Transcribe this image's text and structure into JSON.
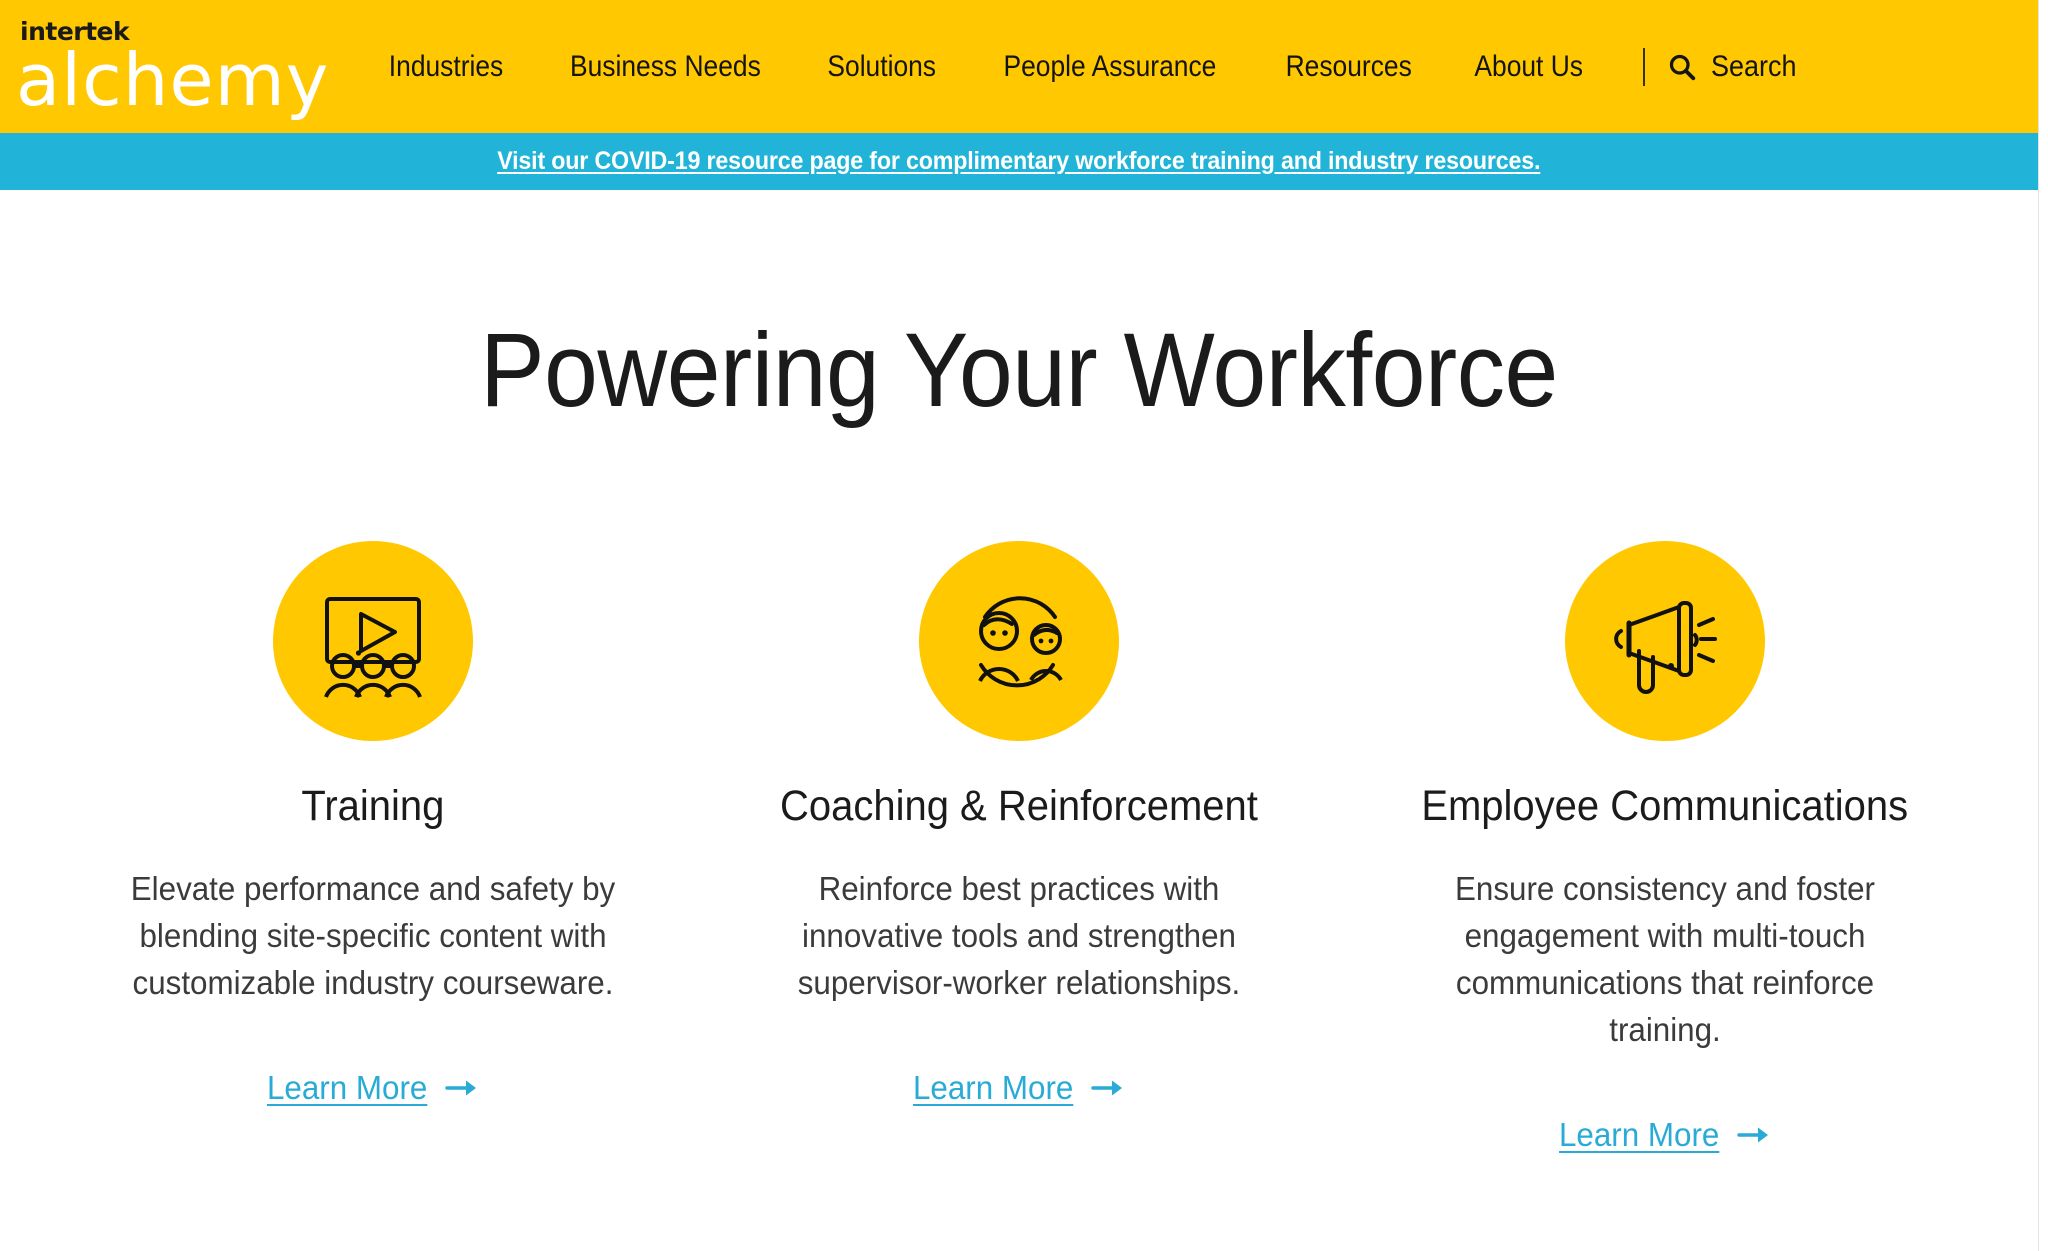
{
  "brand": {
    "logo_top": "intertek",
    "logo_bottom": "alchemy",
    "yellow": "#FFC800",
    "cyan": "#22B4D8",
    "link_cyan": "#29ABD6"
  },
  "header": {
    "nav_items": [
      {
        "label": "Industries"
      },
      {
        "label": "Business Needs"
      },
      {
        "label": "Solutions"
      },
      {
        "label": "People Assurance"
      },
      {
        "label": "Resources"
      },
      {
        "label": "About Us"
      }
    ],
    "search": {
      "icon": "search-icon",
      "label": "Search"
    }
  },
  "banner": {
    "text": "Visit our COVID-19 resource page for complimentary workforce training and industry resources."
  },
  "main": {
    "title": "Powering Your Workforce",
    "cards": [
      {
        "icon": "video-training-screen-icon",
        "title": "Training",
        "description": "Elevate performance and safety by blending site-specific content with customizable industry courseware.",
        "link_label": "Learn More",
        "link_arrow": "arrow-right-icon"
      },
      {
        "icon": "two-people-cycle-icon",
        "title": "Coaching & Reinforcement",
        "description": "Reinforce best practices with innovative tools and strengthen supervisor-worker relationships.",
        "link_label": "Learn More",
        "link_arrow": "arrow-right-icon"
      },
      {
        "icon": "megaphone-icon",
        "title": "Employee Communications",
        "description": "Ensure consistency and foster engagement with multi-touch communications that reinforce training.",
        "link_label": "Learn More",
        "link_arrow": "arrow-right-icon"
      }
    ]
  }
}
